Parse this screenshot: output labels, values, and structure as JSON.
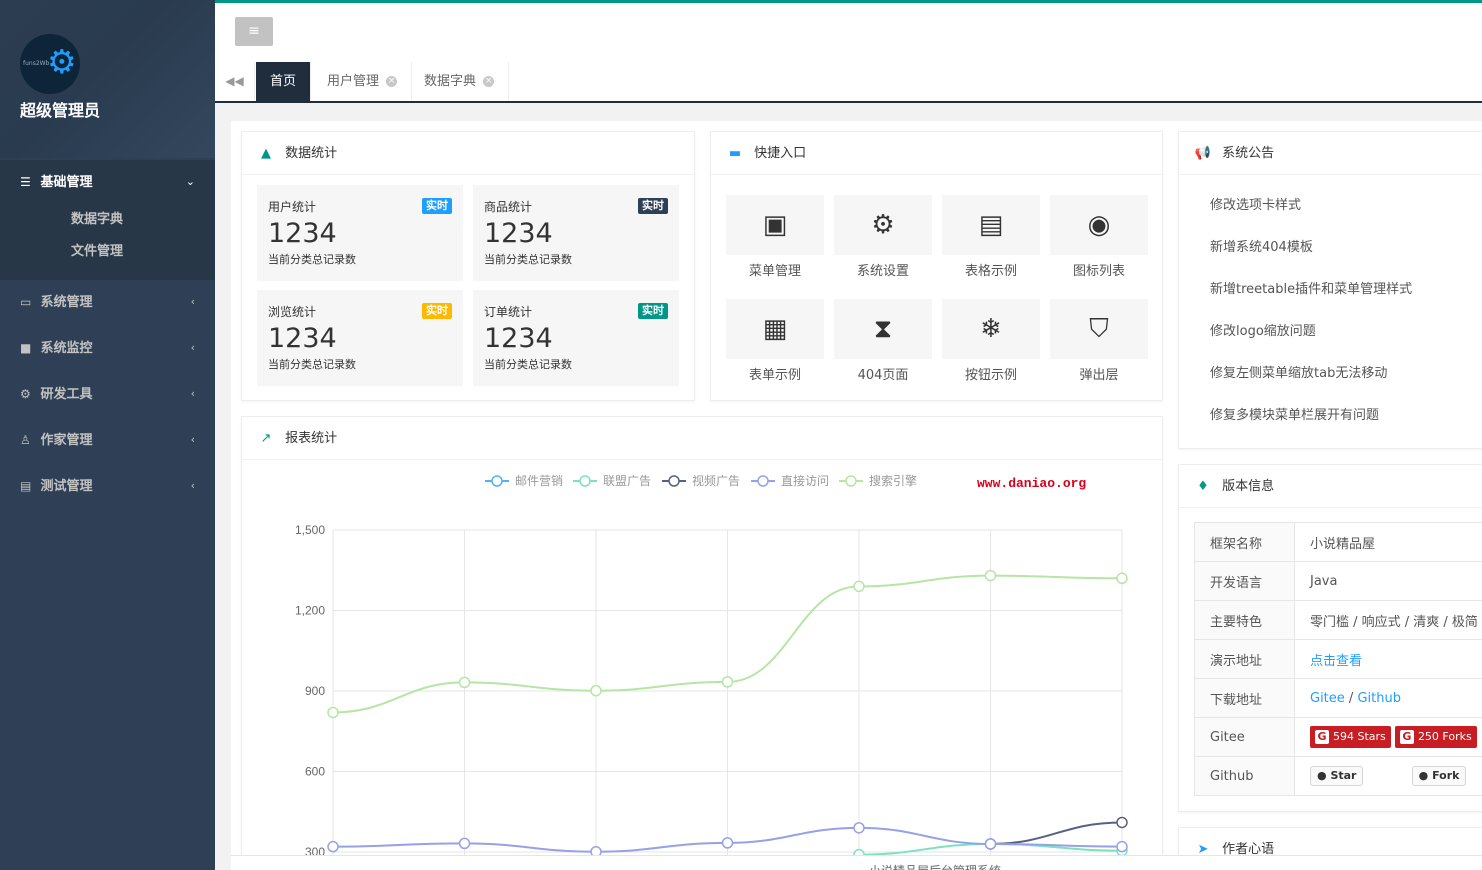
{
  "sidebar": {
    "title": "超级管理员",
    "logo_text": "funs2Wb",
    "menus": [
      {
        "label": "基础管理",
        "icon": "list-icon",
        "children": [
          "数据字典",
          "文件管理"
        ]
      },
      {
        "label": "系统管理",
        "icon": "monitor-icon"
      },
      {
        "label": "系统监控",
        "icon": "video-icon"
      },
      {
        "label": "研发工具",
        "icon": "gear-icon"
      },
      {
        "label": "作家管理",
        "icon": "user-icon"
      },
      {
        "label": "测试管理",
        "icon": "folder-icon"
      }
    ]
  },
  "tabs": [
    {
      "label": "首页",
      "active": true
    },
    {
      "label": "用户管理",
      "active": false
    },
    {
      "label": "数据字典",
      "active": false
    }
  ],
  "stats": {
    "title": "数据统计",
    "items": [
      {
        "label": "用户统计",
        "badge": "实时",
        "badge_color": "#1e9fff",
        "value": "1234",
        "desc": "当前分类总记录数"
      },
      {
        "label": "商品统计",
        "badge": "实时",
        "badge_color": "#2f4056",
        "value": "1234",
        "desc": "当前分类总记录数"
      },
      {
        "label": "浏览统计",
        "badge": "实时",
        "badge_color": "#ffb800",
        "value": "1234",
        "desc": "当前分类总记录数"
      },
      {
        "label": "订单统计",
        "badge": "实时",
        "badge_color": "#009688",
        "value": "1234",
        "desc": "当前分类总记录数"
      }
    ]
  },
  "quick": {
    "title": "快捷入口",
    "items": [
      {
        "label": "菜单管理",
        "icon": "window-icon"
      },
      {
        "label": "系统设置",
        "icon": "gears-icon"
      },
      {
        "label": "表格示例",
        "icon": "file-icon"
      },
      {
        "label": "图标列表",
        "icon": "dot-circle-icon"
      },
      {
        "label": "表单示例",
        "icon": "calendar-icon"
      },
      {
        "label": "404页面",
        "icon": "hourglass-icon"
      },
      {
        "label": "按钮示例",
        "icon": "snowflake-icon"
      },
      {
        "label": "弹出层",
        "icon": "shield-icon"
      }
    ]
  },
  "notice": {
    "title": "系统公告",
    "items": [
      "修改选项卡样式",
      "新增系统404模板",
      "新增treetable插件和菜单管理样式",
      "修改logo缩放问题",
      "修复左侧菜单缩放tab无法移动",
      "修复多模块菜单栏展开有问题"
    ]
  },
  "version": {
    "title": "版本信息",
    "rows": [
      {
        "k": "框架名称",
        "v": "小说精品屋"
      },
      {
        "k": "开发语言",
        "v": "Java"
      },
      {
        "k": "主要特色",
        "v": "零门槛 / 响应式 / 清爽 / 极简"
      },
      {
        "k": "演示地址",
        "v": "点击查看"
      },
      {
        "k": "下载地址",
        "gitee": "Gitee",
        "sep": " / ",
        "github": "Github"
      },
      {
        "k": "Gitee",
        "stars": "594 Stars",
        "forks": "250 Forks"
      },
      {
        "k": "Github",
        "star_btn": "Star",
        "fork_btn": "Fork"
      }
    ]
  },
  "author": {
    "title": "作者心语"
  },
  "report": {
    "title": "报表统计",
    "watermark": "www.daniao.org",
    "footer_partial": "小说精品屋后台管理系统"
  },
  "chart_data": {
    "type": "line",
    "x": [
      "",
      "",
      "",
      "",
      "",
      "",
      ""
    ],
    "ylim": [
      300,
      1500
    ],
    "yticks": [
      300,
      600,
      900,
      1200,
      1500
    ],
    "ytick_labels": [
      "300",
      "600",
      "900",
      "1,200",
      "1,500"
    ],
    "grid": true,
    "legend_position": "top-center",
    "series": [
      {
        "name": "邮件营销",
        "color": "#5ab1ef",
        "values": [
          null,
          null,
          null,
          null,
          null,
          null,
          null
        ]
      },
      {
        "name": "联盟广告",
        "color": "#7ee0c3",
        "values": [
          null,
          null,
          null,
          null,
          290,
          330,
          305
        ]
      },
      {
        "name": "视频广告",
        "color": "#56627f",
        "values": [
          null,
          null,
          null,
          null,
          null,
          330,
          410
        ]
      },
      {
        "name": "直接访问",
        "color": "#95a2e6",
        "values": [
          320,
          332,
          301,
          334,
          390,
          330,
          320
        ]
      },
      {
        "name": "搜索引擎",
        "color": "#b5e6a4",
        "values": [
          820,
          932,
          901,
          934,
          1290,
          1330,
          1320
        ]
      }
    ]
  }
}
